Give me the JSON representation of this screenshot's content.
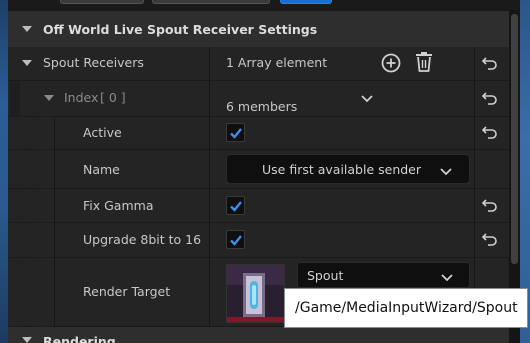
{
  "panel": {
    "section_title": "Off World Live Spout Receiver Settings",
    "next_section_title": "Rendering"
  },
  "spout_receivers": {
    "label": "Spout Receivers",
    "value": "1 Array element"
  },
  "index_row": {
    "label": "Index",
    "index_text": "[ 0 ]",
    "value": "6 members"
  },
  "properties": {
    "active": {
      "label": "Active",
      "checked": true
    },
    "name": {
      "label": "Name",
      "value": "Use first available sender"
    },
    "fix_gamma": {
      "label": "Fix Gamma",
      "checked": true
    },
    "upgrade": {
      "label": "Upgrade 8bit to 16",
      "checked": true
    },
    "render_target": {
      "label": "Render Target",
      "asset": "Spout"
    }
  },
  "tooltip": {
    "text": "/Game/MediaInputWizard/Spout"
  },
  "icons": {
    "add": "add-circle-icon",
    "delete": "trash-icon",
    "reset": "reset-arrow-icon",
    "expand": "triangle-down-icon",
    "dropdown": "chevron-down-icon"
  },
  "colors": {
    "accent": "#1a6fd6",
    "check": "#3d8ef0"
  }
}
